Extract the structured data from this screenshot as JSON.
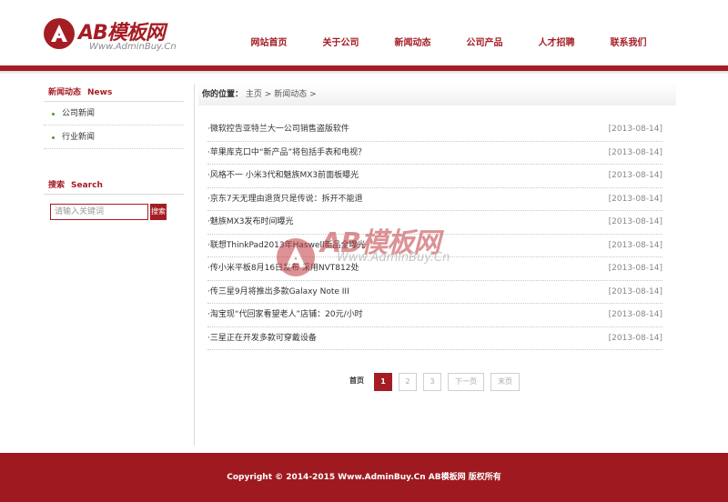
{
  "header": {
    "logo_text": "AB模板网",
    "logo_sub": "Www.AdminBuy.Cn",
    "nav": [
      {
        "label": "网站首页"
      },
      {
        "label": "关于公司"
      },
      {
        "label": "新闻动态"
      },
      {
        "label": "公司产品"
      },
      {
        "label": "人才招聘"
      },
      {
        "label": "联系我们"
      }
    ]
  },
  "sidebar": {
    "news_title_cn": "新闻动态",
    "news_title_en": "News",
    "items": [
      {
        "label": "公司新闻"
      },
      {
        "label": "行业新闻"
      }
    ],
    "search_title_cn": "搜索",
    "search_title_en": "Search",
    "search_placeholder": "请输入关键词",
    "search_button": "搜索"
  },
  "breadcrumb": {
    "label": "你的位置：",
    "home": "主页",
    "sep": ">",
    "current": "新闻动态",
    "trail": ">"
  },
  "news": [
    {
      "title": "·微软控告亚特兰大一公司销售盗版软件",
      "date": "[2013-08-14]"
    },
    {
      "title": "·苹果库克口中“新产品”将包括手表和电视？",
      "date": "[2013-08-14]"
    },
    {
      "title": "·风格不一 小米3代和魅族MX3前面板曝光",
      "date": "[2013-08-14]"
    },
    {
      "title": "·京东7天无理由退货只是传说：拆开不能退",
      "date": "[2013-08-14]"
    },
    {
      "title": "·魅族MX3发布时间曝光",
      "date": "[2013-08-14]"
    },
    {
      "title": "·联想ThinkPad2013年Haswell新品全曝光",
      "date": "[2013-08-14]"
    },
    {
      "title": "·传小米平板8月16日发布 采用NVT812处",
      "date": "[2013-08-14]"
    },
    {
      "title": "·传三星9月将推出多款Galaxy Note III",
      "date": "[2013-08-14]"
    },
    {
      "title": "·淘宝现“代回家看望老人”店铺：20元/小时",
      "date": "[2013-08-14]"
    },
    {
      "title": "·三星正在开发多款可穿戴设备",
      "date": "[2013-08-14]"
    }
  ],
  "pager": {
    "first": "首页",
    "pages": [
      "1",
      "2",
      "3"
    ],
    "current": "1",
    "next": "下一页",
    "last": "末页"
  },
  "watermark": {
    "text": "AB模板网",
    "sub": "Www.AdminBuy.Cn"
  },
  "footer": {
    "copyright": "Copyright © 2014-2015 Www.AdminBuy.Cn AB模板网 版权所有"
  },
  "colors": {
    "brand": "#a51d24",
    "footer": "#9e1a20",
    "bullet": "#4f9a2f"
  }
}
